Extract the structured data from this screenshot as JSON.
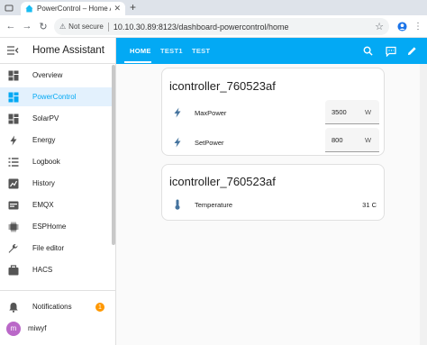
{
  "browser": {
    "tab_title": "PowerControl – Home Assistant",
    "tab_close": "✕",
    "new_tab": "+",
    "security_label": "Not secure",
    "url": "10.10.30.89:8123/dashboard-powercontrol/home"
  },
  "sidebar": {
    "title": "Home Assistant",
    "items": [
      {
        "label": "Overview",
        "icon": "overview-icon"
      },
      {
        "label": "PowerControl",
        "icon": "dashboard-icon"
      },
      {
        "label": "SolarPV",
        "icon": "dashboard-icon"
      },
      {
        "label": "Energy",
        "icon": "energy-icon"
      },
      {
        "label": "Logbook",
        "icon": "logbook-icon"
      },
      {
        "label": "History",
        "icon": "history-icon"
      },
      {
        "label": "EMQX",
        "icon": "emqx-icon"
      },
      {
        "label": "ESPHome",
        "icon": "esphome-icon"
      },
      {
        "label": "File editor",
        "icon": "wrench-icon"
      },
      {
        "label": "HACS",
        "icon": "hacs-icon"
      }
    ],
    "notifications": {
      "label": "Notifications",
      "count": "1"
    },
    "user": {
      "name": "miwyf",
      "initial": "m"
    },
    "active_color": "#03a9f4"
  },
  "header": {
    "tabs": [
      "HOME",
      "TEST1",
      "TEST"
    ],
    "active_tab": "HOME",
    "color": "#03a9f4"
  },
  "cards": [
    {
      "title": "icontroller_760523af",
      "rows": [
        {
          "name": "MaxPower",
          "value": "3500",
          "unit": "W",
          "icon": "flash-icon"
        },
        {
          "name": "SetPower",
          "value": "800",
          "unit": "W",
          "icon": "flash-icon"
        }
      ]
    },
    {
      "title": "icontroller_760523af",
      "rows": [
        {
          "name": "Temperature",
          "value": "31 C",
          "icon": "thermometer-icon"
        }
      ]
    }
  ]
}
